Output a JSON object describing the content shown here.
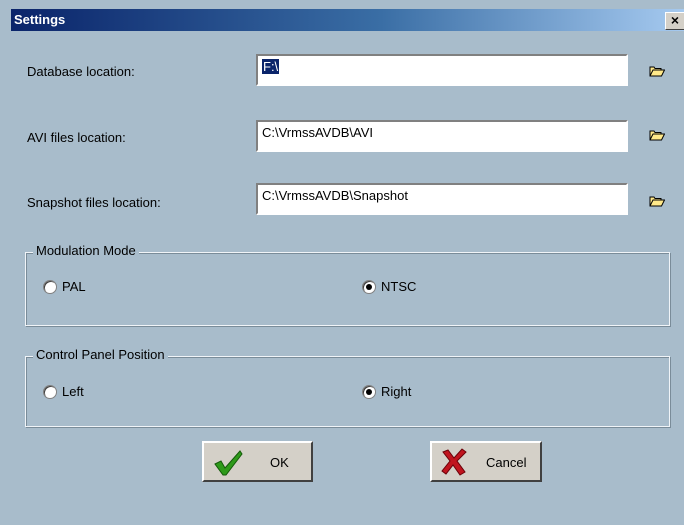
{
  "window": {
    "title": "Settings",
    "close_glyph": "×"
  },
  "fields": [
    {
      "label": "Database location:",
      "value": "F:\\",
      "browse_icon": "folder-open-icon"
    },
    {
      "label": "AVI files location:",
      "value": "C:\\VrmssAVDB\\AVI",
      "browse_icon": "folder-open-icon"
    },
    {
      "label": "Snapshot files location:",
      "value": "C:\\VrmssAVDB\\Snapshot",
      "browse_icon": "folder-open-icon"
    }
  ],
  "modulation": {
    "title": "Modulation Mode",
    "options": [
      "PAL",
      "NTSC"
    ],
    "selected": "NTSC"
  },
  "panel_position": {
    "title": "Control Panel Position",
    "options": [
      "Left",
      "Right"
    ],
    "selected": "Right"
  },
  "buttons": {
    "ok": "OK",
    "cancel": "Cancel"
  },
  "colors": {
    "dialog_bg": "#a8bccb",
    "title_bar": "#0a246a",
    "ok_check": "#2e9a1a",
    "cancel_x": "#c0141e"
  }
}
